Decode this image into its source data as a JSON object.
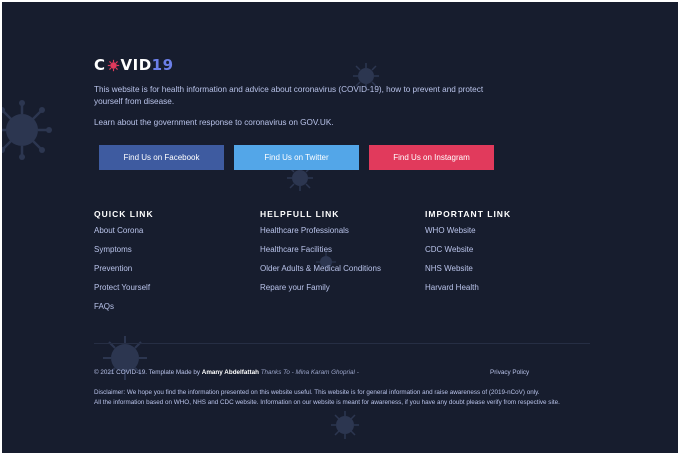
{
  "logo": {
    "prefix": "C",
    "suffix": "VID",
    "number": "19",
    "accent_color": "#e13a5c"
  },
  "about": {
    "description": "This website is for health information and advice about coronavirus (COVID-19), how to prevent and protect yourself from disease.",
    "gov_text": "Learn about the government response to coronavirus on GOV.UK."
  },
  "social": {
    "facebook": "Find Us on Facebook",
    "twitter": "Find Us on Twitter",
    "instagram": "Find Us on Instagram"
  },
  "columns": [
    {
      "title": "QUICK LINK",
      "items": [
        "About Corona",
        "Symptoms",
        "Prevention",
        "Protect Yourself",
        "FAQs"
      ]
    },
    {
      "title": "HELPFULL LINK",
      "items": [
        "Healthcare Professionals",
        "Healthcare Facilities",
        "Older Adults & Medical Conditions",
        "Repare your Family"
      ]
    },
    {
      "title": "IMPORTANT LINK",
      "items": [
        "WHO Website",
        "CDC Website",
        "NHS Website",
        "Harvard Health"
      ]
    }
  ],
  "footer": {
    "copyright": "© 2021 COVID-19. Template Made by",
    "author": "Amany Abdelfattah",
    "thanks": "Thanks To - Mina Karam Ghoprial -",
    "privacy": "Privacy Policy",
    "disclaimer_1": "Disclaimer: We hope you find the information presented on this website useful. This website is for general information and raise awareness of (2019-nCoV) only.",
    "disclaimer_2": "All the information based on WHO, NHS and CDC website. Information on our website is meant for awareness, if you have any doubt please verify from respective site."
  },
  "icons": [
    "virus-icon",
    "virus-logo-icon"
  ],
  "colors": {
    "background": "#171d2e",
    "facebook": "#3e5ba0",
    "twitter": "#53a6e8",
    "instagram": "#e13a5c"
  }
}
